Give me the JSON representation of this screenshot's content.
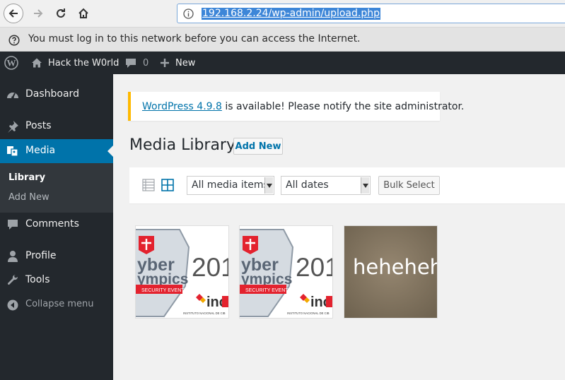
{
  "browser": {
    "url": "192.168.2.24/wp-admin/upload.php",
    "notification": "You must log in to this network before you can access the Internet."
  },
  "admin_bar": {
    "site_name": "Hack the W0rld",
    "comments_count": "0",
    "new_label": "New"
  },
  "sidebar": {
    "dashboard": "Dashboard",
    "posts": "Posts",
    "media": "Media",
    "submenu": {
      "library": "Library",
      "add_new": "Add New"
    },
    "comments": "Comments",
    "profile": "Profile",
    "tools": "Tools",
    "collapse": "Collapse menu"
  },
  "notice": {
    "link_text": "WordPress 4.9.8",
    "rest_text": " is available! Please notify the site administrator."
  },
  "page": {
    "title": "Media Library",
    "add_new": "Add New"
  },
  "toolbar": {
    "media_filter": "All media items",
    "date_filter": "All dates",
    "bulk_select": "Bulk Select"
  },
  "media_items": [
    {
      "label_big": "201",
      "line1": "yber",
      "line2": "ympics",
      "ribbon": "SECURITY EVENT",
      "brand": "inc",
      "footer": "INSTITUTO NACIONAL DE CIB"
    },
    {
      "label_big": "201",
      "line1": "yber",
      "line2": "ympics",
      "ribbon": "SECURITY EVENT",
      "brand": "inc",
      "footer": "INSTITUTO NACIONAL DE CIB"
    },
    {
      "text": "heheheh"
    }
  ],
  "colors": {
    "admin_dark": "#23282d",
    "wp_blue": "#0073aa",
    "notice_yellow": "#ffb900",
    "ribbon_red": "#e3222e"
  }
}
